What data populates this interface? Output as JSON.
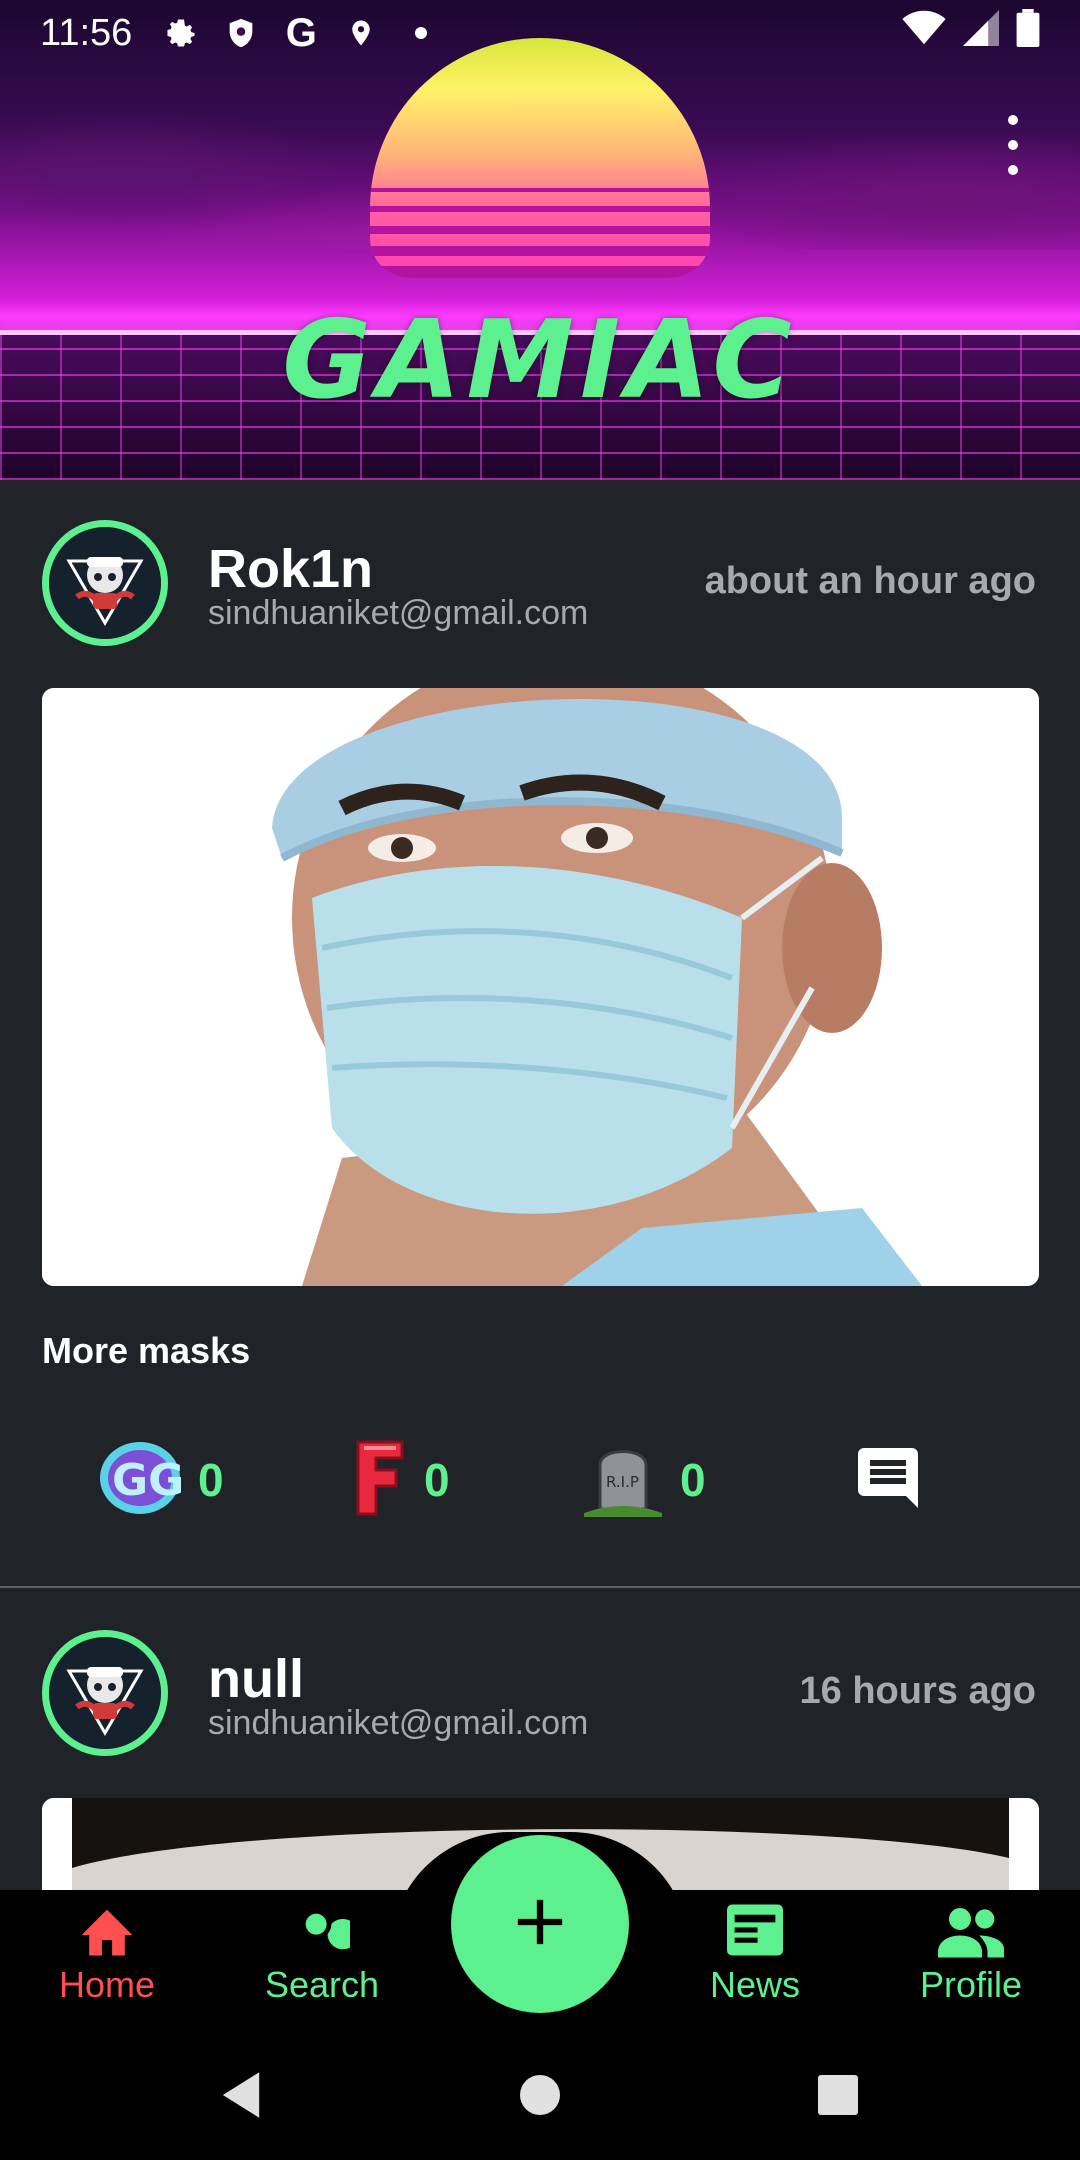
{
  "status_bar": {
    "time": "11:56"
  },
  "app": {
    "logo_text": "GAMIAC"
  },
  "posts": [
    {
      "username": "Rok1n",
      "email": "sindhuaniket@gmail.com",
      "time_ago": "about an hour ago",
      "caption": "More masks",
      "reactions": {
        "gg_count": "0",
        "f_count": "0",
        "rip_count": "0"
      }
    },
    {
      "username": "null",
      "email": "sindhuaniket@gmail.com",
      "time_ago": "16 hours ago"
    }
  ],
  "bottom_nav": {
    "items": [
      {
        "label": "Home",
        "icon": "home-icon",
        "active": true
      },
      {
        "label": "Search",
        "icon": "search-icon",
        "active": false
      },
      {
        "label": "News",
        "icon": "news-icon",
        "active": false
      },
      {
        "label": "Profile",
        "icon": "people-icon",
        "active": false
      }
    ],
    "fab_icon": "plus-icon"
  },
  "colors": {
    "accent": "#5df08f",
    "active_nav": "#ff4f4f",
    "background": "#202327"
  }
}
